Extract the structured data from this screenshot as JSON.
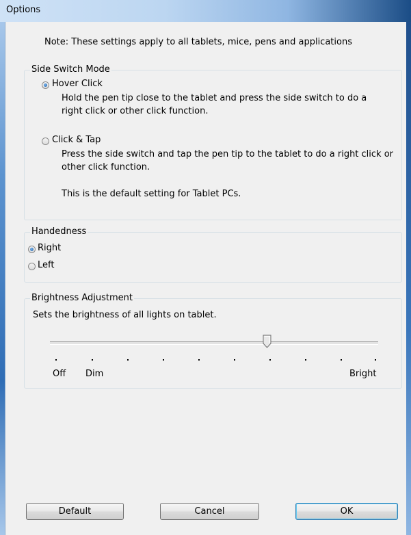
{
  "window": {
    "title": "Options"
  },
  "note": "Note: These settings apply to all tablets, mice, pens and applications",
  "side_switch": {
    "legend": "Side Switch Mode",
    "options": [
      {
        "label": "Hover Click",
        "description": "Hold the pen tip close to the tablet and press the side switch to do a right click or other click function.",
        "checked": true
      },
      {
        "label": "Click & Tap",
        "description": "Press the side switch and tap the pen tip to the tablet to do a right click or other click function.",
        "extra": "This is the default setting for Tablet PCs.",
        "checked": false
      }
    ]
  },
  "handedness": {
    "legend": "Handedness",
    "options": [
      {
        "label": "Right",
        "checked": true
      },
      {
        "label": "Left",
        "checked": false
      }
    ]
  },
  "brightness": {
    "legend": "Brightness Adjustment",
    "description": "Sets the brightness of all lights on tablet.",
    "labels": {
      "off": "Off",
      "dim": "Dim",
      "bright": "Bright"
    },
    "ticks": 10,
    "value_step": 6
  },
  "buttons": {
    "default": "Default",
    "cancel": "Cancel",
    "ok": "OK"
  }
}
